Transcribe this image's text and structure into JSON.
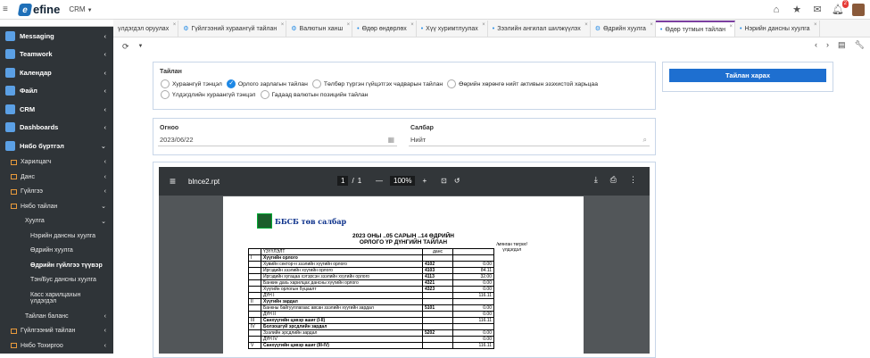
{
  "app": {
    "logo_text": "efine",
    "module": "CRM",
    "notification_count": "2"
  },
  "sidebar": {
    "items": [
      {
        "label": "Messaging",
        "id": "messaging"
      },
      {
        "label": "Teamwork",
        "id": "teamwork"
      },
      {
        "label": "Календар",
        "id": "calendar"
      },
      {
        "label": "Файл",
        "id": "file"
      },
      {
        "label": "CRM",
        "id": "crm"
      },
      {
        "label": "Dashboards",
        "id": "dashboards"
      },
      {
        "label": "Нябо бүртгэл",
        "id": "accounting"
      }
    ],
    "subs": [
      {
        "label": "Харилцагч"
      },
      {
        "label": "Данс"
      },
      {
        "label": "Гүйлгээ"
      },
      {
        "label": "Нябо тайлан"
      },
      {
        "label": "Хуулга"
      },
      {
        "label": "Нэрийн дансны хуулга"
      },
      {
        "label": "Өдрийн хуулга"
      },
      {
        "label": "Өдрийн гүйлгээ түүвэр"
      },
      {
        "label": "Тэн/Бус дансны хуулга"
      },
      {
        "label": "Касс харилцахын"
      },
      {
        "label": "үлдэгдэл"
      },
      {
        "label": "Тайлан баланс"
      },
      {
        "label": "Гүйлгээний тайлан"
      },
      {
        "label": "Нябо Тохиргоо"
      }
    ]
  },
  "tabs": [
    {
      "label": "үлдэгдэл оруулах"
    },
    {
      "label": "Гүйлгээний хураангүй тайлан"
    },
    {
      "label": "Валютын ханш"
    },
    {
      "label": "Өдөр өндөрлөх"
    },
    {
      "label": "Хүү хуримтлуулах"
    },
    {
      "label": "Зээлийн ангилал шилжүүлэх"
    },
    {
      "label": "Өдрийн хуулга"
    },
    {
      "label": "Өдөр тутмын тайлан"
    },
    {
      "label": "Нэрийн дансны хуулга"
    }
  ],
  "report": {
    "title": "Тайлан",
    "options": [
      "Хураангүй тэнцэл",
      "Орлого зарлагын тайлан",
      "Төлбөр түргэн гүйцэтгэх чадварын тайлан",
      "Өөрийн хөрөнгө нийт активын эзэхистой харьцаа",
      "Үлдэгдлийн хураангүй тэнцэл",
      "Гадаад валютын позицийн тайлан"
    ],
    "selected": "Орлого зарлагын тайлан",
    "view_button": "Тайлан харах"
  },
  "filters": {
    "date_label": "Огноо",
    "date_value": "2023/06/22",
    "branch_label": "Салбар",
    "branch_value": "Нийт"
  },
  "pdf": {
    "filename": "blnce2.rpt",
    "page_current": "1",
    "page_sep": "/",
    "page_total": "1",
    "zoom": "100%",
    "brand": "ББСБ төв салбар",
    "heading1": "2023 ОНЫ ..05 САРЫН ..14 ӨДРИЙН",
    "heading2": "ОРЛОГО ҮР ДҮНГИЙН ТАЙЛАН",
    "unit_note": "/мянган төгрөг/",
    "unit_note2": "үлдэгдэл",
    "col_name": "ҮЗҮҮЛЭЛТ",
    "col_acc": "данс",
    "rows": [
      {
        "n": "I",
        "name": "Хүүгийн орлого",
        "acc": "",
        "val": "",
        "bold": true
      },
      {
        "n": "",
        "name": "Хувийн сектор-н зээлийн хүүгийн орлого",
        "acc": "4102",
        "val": "0.00"
      },
      {
        "n": "",
        "name": "Иргэдийн зээлийн хүүгийн орлого",
        "acc": "4103",
        "val": "84.11"
      },
      {
        "n": "",
        "name": "Иргэдийн хугацаа хэтэрсэн зээлийн хүүгийн орлого",
        "acc": "4113",
        "val": "32.00"
      },
      {
        "n": "",
        "name": "Банкин дахь харилцах дансны хүүгийн орлого",
        "acc": "4321",
        "val": "0.00"
      },
      {
        "n": "",
        "name": "Хүүгийн орлогын бүцаалт",
        "acc": "4323",
        "val": "0.00"
      },
      {
        "n": "",
        "name": "ДҮН  I",
        "acc": "",
        "val": "116.11"
      },
      {
        "n": "II",
        "name": "Хүүгийн зардал",
        "acc": "",
        "val": "",
        "bold": true
      },
      {
        "n": "",
        "name": "Банкны байгууллагаас авсан зээлийн хүүгийн зардал",
        "acc": "5101",
        "val": "0.00"
      },
      {
        "n": "",
        "name": "ДҮН  II",
        "acc": "",
        "val": "0.00"
      },
      {
        "n": "III",
        "name": "Санхүүгийн цэвэр ашиг (I-II)",
        "acc": "",
        "val": "116.11",
        "bold": true
      },
      {
        "n": "IV",
        "name": "Болзошгүй эрсдлийн зардал",
        "acc": "",
        "val": "",
        "bold": true
      },
      {
        "n": "",
        "name": "Зээлийн эрсдлийн зардал",
        "acc": "5202",
        "val": "0.00"
      },
      {
        "n": "",
        "name": "ДҮН  IV",
        "acc": "",
        "val": "0.00"
      },
      {
        "n": "V",
        "name": "Санхүүгийн цэвэр ашиг (III-IV)",
        "acc": "",
        "val": "116.11",
        "bold": true
      }
    ]
  }
}
